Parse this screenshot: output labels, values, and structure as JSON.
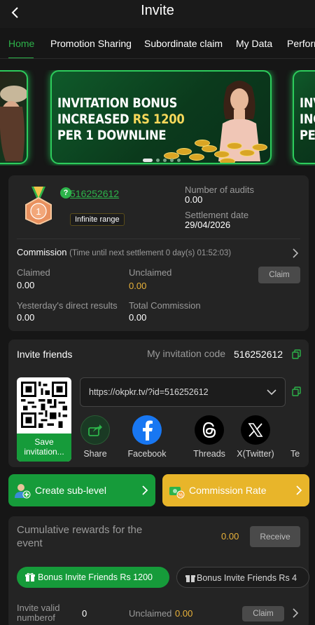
{
  "header": {
    "title": "Invite",
    "back_icon": "chevron-left-icon"
  },
  "tabs": [
    {
      "label": "Home",
      "active": true
    },
    {
      "label": "Promotion Sharing",
      "active": false
    },
    {
      "label": "Subordinate claim",
      "active": false
    },
    {
      "label": "My Data",
      "active": false
    },
    {
      "label": "Performance",
      "active": false
    }
  ],
  "banner": {
    "main": {
      "line1": "INVITATION BONUS",
      "line2_prefix": "INCREASED ",
      "line2_amount": "RS 1200",
      "line3": "PER 1 DOWNLINE"
    },
    "right_peek": {
      "line1": "INV",
      "line2": "INC",
      "line3": "PER"
    },
    "pages": 5,
    "active_page": 1
  },
  "agent": {
    "level": "1",
    "user_id": "516252612",
    "range_badge": "Infinite range",
    "audits_label": "Number of audits",
    "audits_value": "0.00",
    "settlement_label": "Settlement date",
    "settlement_value": "29/04/2026"
  },
  "commission": {
    "title": "Commission",
    "countdown": "(Time until next settlement 0 day(s) 01:52:03)",
    "claimed_label": "Claimed",
    "claimed_value": "0.00",
    "unclaimed_label": "Unclaimed",
    "unclaimed_value": "0.00",
    "claim_button": "Claim",
    "yesterday_label": "Yesterday's direct results",
    "yesterday_value": "0.00",
    "total_label": "Total Commission",
    "total_value": "0.00"
  },
  "invite": {
    "title": "Invite friends",
    "code_label": "My invitation code",
    "code": "516252612",
    "url": "https://okpkr.tv/?id=516252612",
    "save_label": "Save invitation...",
    "share": [
      {
        "label": "Share",
        "icon": "share-icon"
      },
      {
        "label": "Facebook",
        "icon": "facebook-icon"
      },
      {
        "label": "Threads",
        "icon": "threads-icon"
      },
      {
        "label": "X(Twitter)",
        "icon": "x-twitter-icon"
      },
      {
        "label": "Te",
        "icon": "telegram-icon"
      }
    ]
  },
  "actions": {
    "create_sub_level": "Create sub-level",
    "commission_rate": "Commission Rate"
  },
  "event": {
    "title": "Cumulative rewards for the event",
    "value": "0.00",
    "receive_button": "Receive",
    "pills": [
      "Bonus Invite Friends Rs 1200",
      "Bonus Invite Friends Rs 4"
    ],
    "valid_label": "Invite valid numberof",
    "valid_value": "0",
    "unclaimed_label": "Unclaimed",
    "unclaimed_value": "0.00",
    "claim_button": "Claim"
  },
  "colors": {
    "accent_green": "#2db34a",
    "button_green": "#169b3a",
    "gold": "#e9b23a",
    "yellow": "#e8b52a",
    "card": "#242424",
    "background": "#161616"
  }
}
